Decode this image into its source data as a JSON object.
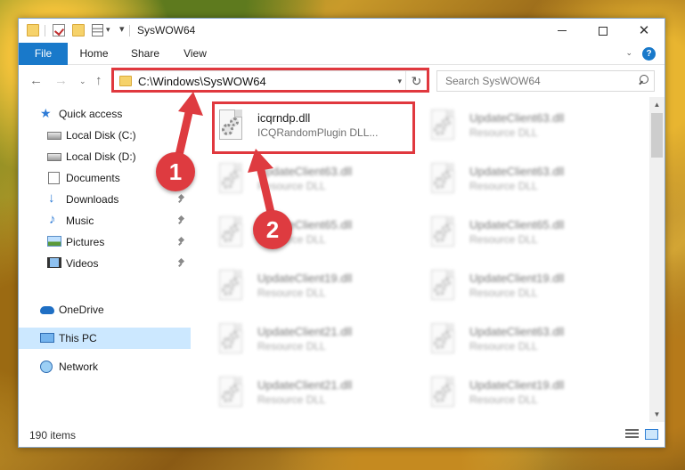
{
  "window": {
    "title": "SysWOW64",
    "controls": {
      "minimize": "minimize-icon",
      "maximize": "maximize-icon",
      "close": "✕"
    }
  },
  "ribbon": {
    "tabs": [
      {
        "label": "File",
        "active": true
      },
      {
        "label": "Home"
      },
      {
        "label": "Share"
      },
      {
        "label": "View"
      }
    ],
    "help": "?"
  },
  "nav": {
    "back": "←",
    "forward": "→",
    "recent": "⌄",
    "up": "↑",
    "address": "C:\\Windows\\SysWOW64",
    "refresh": "↻",
    "search_placeholder": "Search SysWOW64"
  },
  "sidebar": {
    "items": [
      {
        "label": "Quick access",
        "icon": "star-icon"
      },
      {
        "label": "Local Disk (C:)",
        "icon": "drive-icon"
      },
      {
        "label": "Local Disk (D:)",
        "icon": "drive-icon"
      },
      {
        "label": "Documents",
        "icon": "documents-icon",
        "pinned": true
      },
      {
        "label": "Downloads",
        "icon": "downloads-icon",
        "pinned": true
      },
      {
        "label": "Music",
        "icon": "music-icon",
        "pinned": true
      },
      {
        "label": "Pictures",
        "icon": "pictures-icon",
        "pinned": true
      },
      {
        "label": "Videos",
        "icon": "videos-icon",
        "pinned": true
      },
      {
        "label": "OneDrive",
        "icon": "onedrive-icon"
      },
      {
        "label": "This PC",
        "icon": "this-pc-icon",
        "selected": true
      },
      {
        "label": "Network",
        "icon": "network-icon"
      }
    ]
  },
  "files": {
    "left": [
      {
        "name": "icqrndp.dll",
        "type": "ICQRandomPlugin DLL...",
        "highlighted": true
      },
      {
        "name": "UpdateClient63.dll",
        "type": "Resource DLL"
      },
      {
        "name": "UpdateClient65.dll",
        "type": "Resource DLL"
      },
      {
        "name": "UpdateClient19.dll",
        "type": "Resource DLL"
      },
      {
        "name": "UpdateClient21.dll",
        "type": "Resource DLL"
      },
      {
        "name": "UpdateClient21.dll",
        "type": "Resource DLL"
      }
    ],
    "right": [
      {
        "name": "UpdateClient63.dll",
        "type": "Resource DLL"
      },
      {
        "name": "UpdateClient63.dll",
        "type": "Resource DLL"
      },
      {
        "name": "UpdateClient65.dll",
        "type": "Resource DLL"
      },
      {
        "name": "UpdateClient19.dll",
        "type": "Resource DLL"
      },
      {
        "name": "UpdateClient63.dll",
        "type": "Resource DLL"
      },
      {
        "name": "UpdateClient19.dll",
        "type": "Resource DLL"
      }
    ]
  },
  "status": {
    "item_count": "190 items"
  },
  "callouts": [
    {
      "label": "1",
      "color": "#de3b40"
    },
    {
      "label": "2",
      "color": "#de3b40"
    }
  ],
  "colors": {
    "accent": "#1979ca",
    "highlight": "#e0383e",
    "selection": "#cce8ff"
  }
}
